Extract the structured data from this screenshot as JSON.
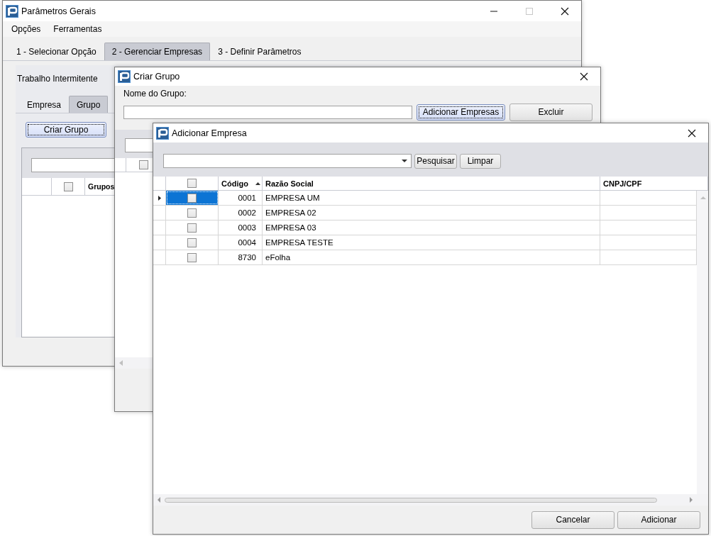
{
  "main_window": {
    "title": "Parâmetros Gerais",
    "menu": [
      "Opções",
      "Ferramentas"
    ],
    "tabs": [
      {
        "label": "1 - Selecionar Opção",
        "selected": false
      },
      {
        "label": "2 - Gerenciar Empresas",
        "selected": true
      },
      {
        "label": "3 - Definir Parâmetros",
        "selected": false
      }
    ],
    "section_title": "Trabalho Intermitente",
    "sub_tabs": [
      {
        "label": "Empresa",
        "selected": false
      },
      {
        "label": "Grupo",
        "selected": true
      }
    ],
    "create_button": "Criar Grupo",
    "header_checked": false,
    "columns": [
      "Grupos"
    ]
  },
  "group_dialog": {
    "title": "Criar Grupo",
    "name_label": "Nome do Grupo:",
    "buttons": [
      {
        "label": "Adicionar Empresas",
        "focused": true
      },
      {
        "label": "Excluir",
        "focused": false
      }
    ],
    "header_checked": false
  },
  "company_dialog": {
    "title": "Adicionar Empresa",
    "search_buttons": [
      "Pesquisar",
      "Limpar"
    ],
    "header_checked": false,
    "columns": [
      {
        "label": "Código",
        "sorted": true
      },
      {
        "label": "Razão Social",
        "sorted": false
      },
      {
        "label": "CNPJ/CPF",
        "sorted": false
      }
    ],
    "rows": [
      {
        "code": "0001",
        "name": "EMPRESA UM",
        "checked": false,
        "selected": true
      },
      {
        "code": "0002",
        "name": "EMPRESA 02",
        "checked": false,
        "selected": false
      },
      {
        "code": "0003",
        "name": "EMPRESA 03",
        "checked": false,
        "selected": false
      },
      {
        "code": "0004",
        "name": "EMPRESA TESTE",
        "checked": false,
        "selected": false
      },
      {
        "code": "8730",
        "name": "eFolha",
        "checked": false,
        "selected": false
      }
    ],
    "footer_buttons": [
      "Cancelar",
      "Adicionar"
    ]
  }
}
